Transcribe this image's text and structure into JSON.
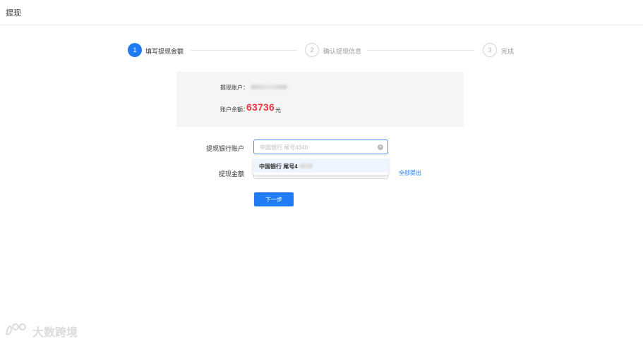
{
  "page": {
    "title": "提现"
  },
  "steps": [
    {
      "number": "1",
      "label": "填写提现金额",
      "status": "active"
    },
    {
      "number": "2",
      "label": "确认提现信息",
      "status": "inactive"
    },
    {
      "number": "3",
      "label": "完成",
      "status": "inactive"
    }
  ],
  "info": {
    "account_label": "提现账户：",
    "balance_label": "账户余额：",
    "balance_value": "63736",
    "balance_unit": "元"
  },
  "form": {
    "bank_label": "提现银行账户",
    "bank_placeholder": "中国银行 尾号4340",
    "amount_label": "提现金额",
    "withdraw_all": "全部提出",
    "next_button": "下一步"
  },
  "dropdown": {
    "option_text": "中国银行 尾号4"
  },
  "watermark": {
    "text": "大数跨境"
  },
  "colors": {
    "primary": "#1f7cf5",
    "balance": "#e8333e"
  }
}
